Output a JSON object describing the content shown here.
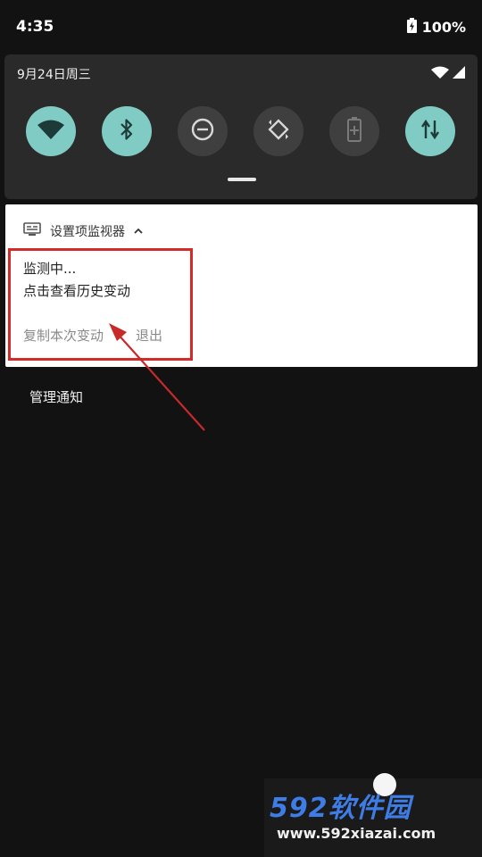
{
  "status_bar": {
    "time": "4:35",
    "battery_percent": "100%"
  },
  "quick_settings": {
    "date": "9月24日周三",
    "tiles": [
      {
        "icon": "wifi-icon",
        "state": "on"
      },
      {
        "icon": "bluetooth-icon",
        "state": "on"
      },
      {
        "icon": "do-not-disturb-icon",
        "state": "off"
      },
      {
        "icon": "auto-rotate-icon",
        "state": "off"
      },
      {
        "icon": "battery-saver-icon",
        "state": "off"
      },
      {
        "icon": "mobile-data-icon",
        "state": "on"
      }
    ]
  },
  "notification": {
    "app_name": "设置项监视器",
    "title": "监测中...",
    "text": "点击查看历史变动",
    "actions": [
      "复制本次变动",
      "退出"
    ]
  },
  "manage_notifications": "管理通知",
  "watermark": {
    "logo_text": "592软件园",
    "url": "www.592xiazai.com"
  },
  "colors": {
    "tile_on": "#80cbc4",
    "tile_off": "#3f3f3f",
    "highlight": "#d32a2a",
    "watermark_blue": "#3f7de6"
  }
}
